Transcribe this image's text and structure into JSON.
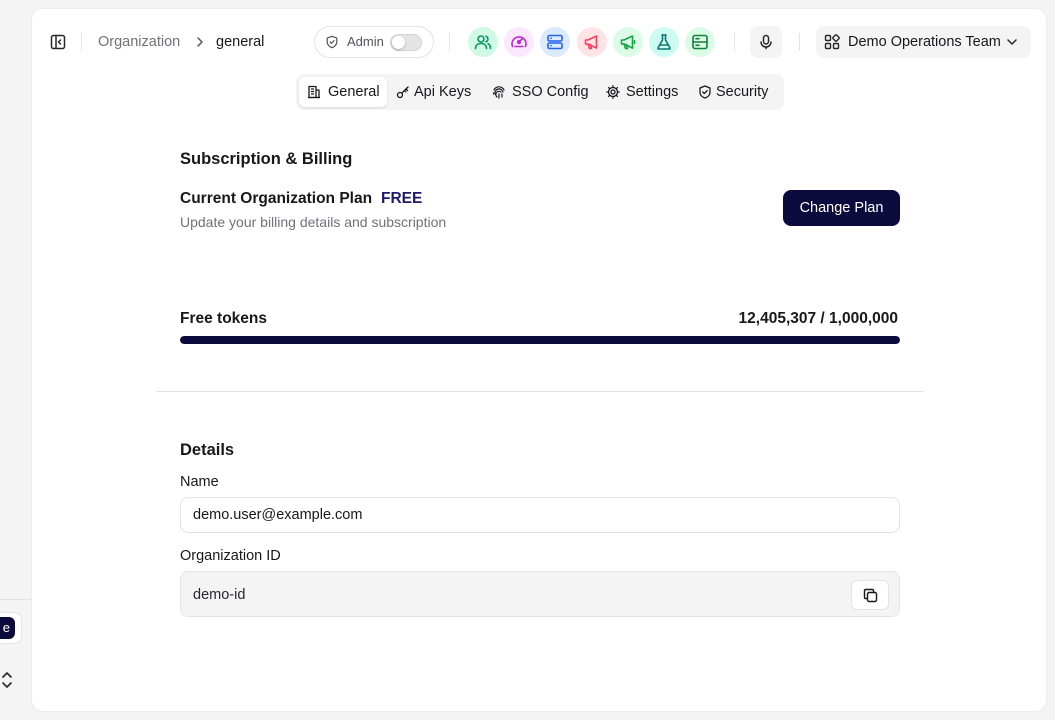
{
  "breadcrumb": {
    "parent": "Organization",
    "current": "general"
  },
  "admin_toggle": {
    "label": "Admin",
    "enabled": false
  },
  "app_icons": [
    {
      "name": "team-icon",
      "bg": "#d1fae5",
      "fg": "#059669"
    },
    {
      "name": "gauge-icon",
      "bg": "#fae8ff",
      "fg": "#c026d3"
    },
    {
      "name": "server-icon",
      "bg": "#dbeafe",
      "fg": "#2563eb"
    },
    {
      "name": "megaphone-icon",
      "bg": "#ffe4e6",
      "fg": "#f43f5e"
    },
    {
      "name": "megaphone-green-icon",
      "bg": "#dcfce7",
      "fg": "#16a34a"
    },
    {
      "name": "flask-icon",
      "bg": "#ccfbf1",
      "fg": "#0f766e"
    },
    {
      "name": "database-icon",
      "bg": "#dcfce7",
      "fg": "#15803d"
    }
  ],
  "team_selector": {
    "label": "Demo Operations Team"
  },
  "tabs": [
    {
      "label": "General",
      "icon": "building-icon",
      "active": true
    },
    {
      "label": "Api Keys",
      "icon": "key-icon",
      "active": false
    },
    {
      "label": "SSO Config",
      "icon": "fingerprint-icon",
      "active": false
    },
    {
      "label": "Settings",
      "icon": "gear-icon",
      "active": false
    },
    {
      "label": "Security",
      "icon": "shield-check-icon",
      "active": false
    }
  ],
  "billing": {
    "section_title": "Subscription & Billing",
    "plan_label": "Current Organization Plan",
    "plan_name": "FREE",
    "subtitle": "Update your billing details and subscription",
    "change_plan_label": "Change Plan"
  },
  "tokens": {
    "label": "Free tokens",
    "value_text": "12,405,307 / 1,000,000",
    "progress_percent": 100
  },
  "details": {
    "section_title": "Details",
    "name_label": "Name",
    "name_value": "demo.user@example.com",
    "org_id_label": "Organization ID",
    "org_id_value": "demo-id"
  },
  "colors": {
    "primary": "#0b0b3d",
    "muted": "#71717a",
    "border": "#e4e4e7"
  }
}
